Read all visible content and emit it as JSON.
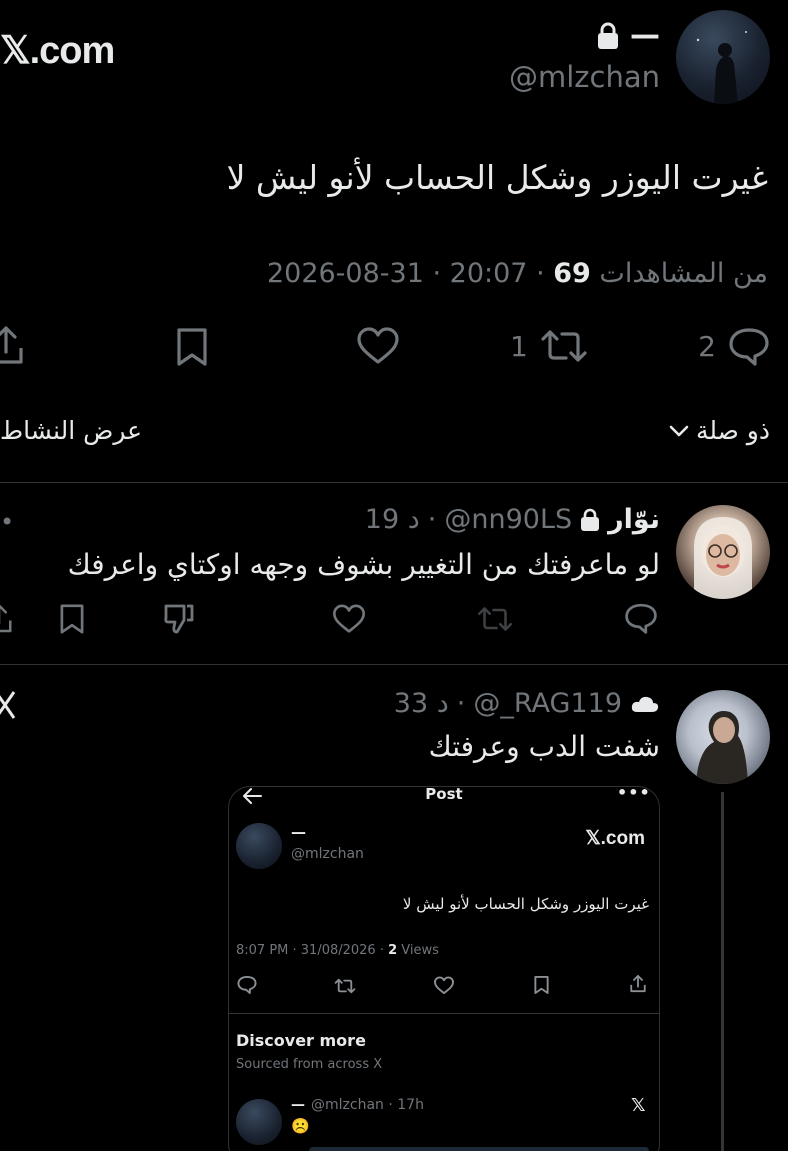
{
  "header": {
    "brand": "𝕏.com",
    "display_name": "—",
    "handle": "@mlzchan"
  },
  "tweet": {
    "text": "غيرت اليوزر وشكل الحساب لأنو ليش لا",
    "date": "2026-08-31",
    "time": "20:07",
    "views_count": "69",
    "views_label": "من المشاهدات",
    "replies": "2",
    "retweets": "1"
  },
  "sort": {
    "relevance_label": "ذو صلة",
    "activity_label": "عرض النشاط"
  },
  "replies": [
    {
      "name": "نوّار",
      "handle": "@nn90LS",
      "time": "19 د",
      "text": "لو ماعرفتك  من التغيير بشوف وجهه اوكتاي واعرفك"
    },
    {
      "handle": "@_RAG119",
      "time": "33 د",
      "text": "شفت الدب وعرفتك"
    }
  ],
  "embedded": {
    "title": "Post",
    "brand": "𝕏.com",
    "name": "—",
    "handle": "@mlzchan",
    "text": "غيرت اليوزر وشكل الحساب لأنو ليش لا",
    "meta_prefix": "8:07 PM · 31/08/2026 · ",
    "views_count": "2",
    "views_label": " Views",
    "discover_title": "Discover more",
    "discover_sub": "Sourced from across X",
    "sub_name": "—",
    "sub_handle": "@mlzchan · 17h",
    "sub_emoji": "☹️"
  },
  "colors": {
    "background": "#000000",
    "text": "#e7e9ea",
    "muted": "#71767b",
    "divider": "#2f3336"
  }
}
